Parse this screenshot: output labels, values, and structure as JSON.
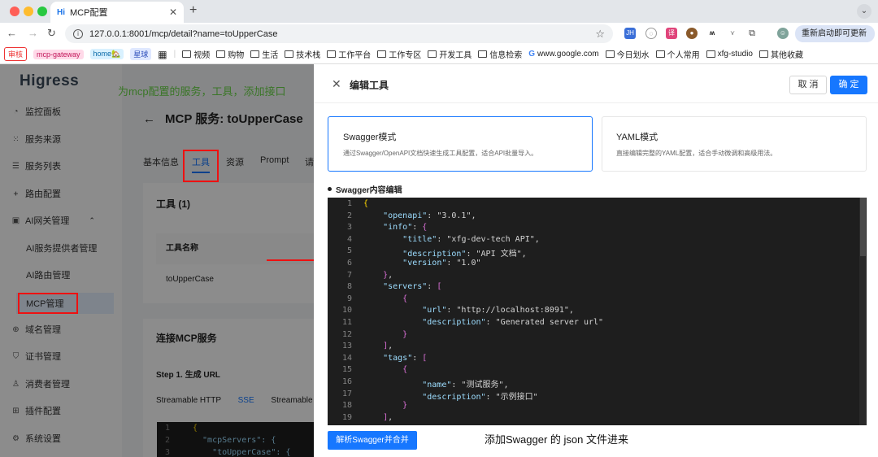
{
  "browser": {
    "tab_title": "MCP配置",
    "tab_favicon": "Hi",
    "url": "127.0.0.1:8001/mcp/detail?name=toUpperCase",
    "update_button": "重新启动即可更新",
    "bookmarks_badges": [
      "审核",
      "mcp-gateway",
      "home🏡",
      "星球"
    ],
    "bookmark_folders": [
      "视频",
      "购物",
      "生活",
      "技术栈",
      "工作平台",
      "工作专区",
      "开发工具",
      "信息检索",
      "www.google.com",
      "今日划水",
      "个人常用",
      "xfg-studio",
      "其他收藏"
    ]
  },
  "app": {
    "logo": "Higress",
    "annotation_top": "为mcp配置的服务，工具，添加接口",
    "annotation_bottom": "添加Swagger 的 json 文件进来",
    "sidebar": [
      {
        "label": "监控面板",
        "icon": "dashboard-icon"
      },
      {
        "label": "服务来源",
        "icon": "source-icon"
      },
      {
        "label": "服务列表",
        "icon": "list-icon"
      },
      {
        "label": "路由配置",
        "icon": "route-icon"
      },
      {
        "label": "AI网关管理",
        "icon": "ai-gateway-icon"
      },
      {
        "label": "AI服务提供者管理",
        "icon": ""
      },
      {
        "label": "AI路由管理",
        "icon": ""
      },
      {
        "label": "MCP管理",
        "icon": ""
      },
      {
        "label": "域名管理",
        "icon": "globe-icon"
      },
      {
        "label": "证书管理",
        "icon": "shield-icon"
      },
      {
        "label": "消费者管理",
        "icon": "user-icon"
      },
      {
        "label": "插件配置",
        "icon": "plugin-icon"
      },
      {
        "label": "系统设置",
        "icon": "gear-icon"
      }
    ],
    "page_title": "MCP 服务: toUpperCase",
    "tabs": [
      "基本信息",
      "工具",
      "资源",
      "Prompt",
      "请"
    ],
    "tools_card_title": "工具 (1)",
    "tools_header": "工具名称",
    "tools_row": "toUpperCase",
    "connect_title": "连接MCP服务",
    "step1": "Step 1. 生成 URL",
    "connect_tabs": [
      "Streamable HTTP",
      "SSE",
      "Streamable"
    ],
    "mini_code": [
      {
        "n": "1",
        "t": "{"
      },
      {
        "n": "2",
        "t": "  \"mcpServers\": {"
      },
      {
        "n": "3",
        "t": "    \"toUpperCase\": {"
      }
    ]
  },
  "drawer": {
    "title": "编辑工具",
    "cancel": "取 消",
    "ok": "确 定",
    "modes": [
      {
        "title": "Swagger模式",
        "desc": "通过Swagger/OpenAPI文档快速生成工具配置，适合API批量导入。"
      },
      {
        "title": "YAML模式",
        "desc": "直接编辑完整的YAML配置，适合手动微调和高级用法。"
      }
    ],
    "section_title": "Swagger内容编辑",
    "parse_button": "解析Swagger并合并",
    "code_lines": [
      "{",
      "    \"openapi\": \"3.0.1\",",
      "    \"info\": {",
      "        \"title\": \"xfg-dev-tech API\",",
      "        \"description\": \"API 文档\",",
      "        \"version\": \"1.0\"",
      "    },",
      "    \"servers\": [",
      "        {",
      "            \"url\": \"http://localhost:8091\",",
      "            \"description\": \"Generated server url\"",
      "        }",
      "    ],",
      "    \"tags\": [",
      "        {",
      "            \"name\": \"测试服务\",",
      "            \"description\": \"示例接口\"",
      "        }",
      "    ],"
    ]
  }
}
